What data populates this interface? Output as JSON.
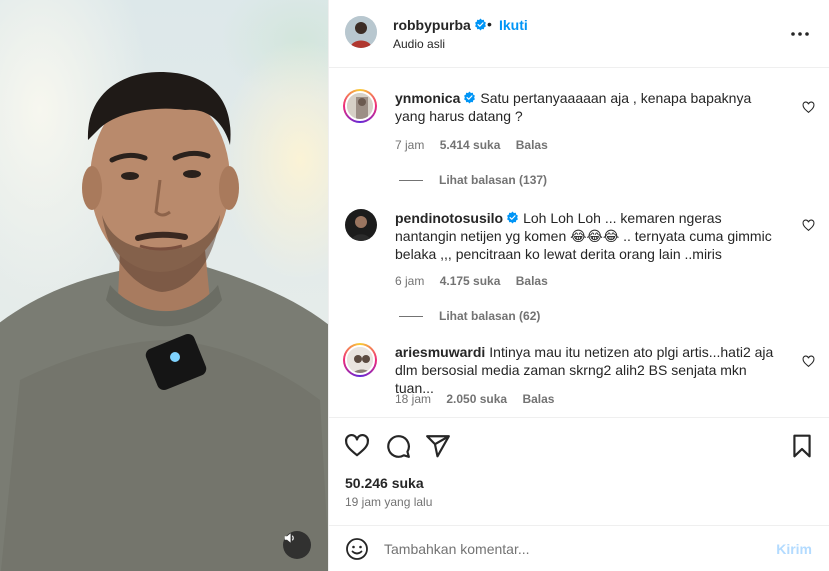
{
  "post": {
    "author": "robbypurba",
    "follow_label": "Ikuti",
    "separator": "•",
    "audio_label": "Audio asli",
    "likes": "50.246 suka",
    "time_ago": "19 jam yang lalu"
  },
  "comments": [
    {
      "username": "ynmonica",
      "verified": true,
      "text": "Satu pertanyaaaaan aja , kenapa bapaknya yang harus datang ?",
      "time": "7 jam",
      "likes": "5.414 suka",
      "reply_label": "Balas",
      "view_replies": "Lihat balasan (137)"
    },
    {
      "username": "pendinotosusilo",
      "verified": true,
      "text": "Loh Loh Loh ... kemaren ngeras nantangin netijen yg komen 😂😂😂 .. ternyata cuma gimmic belaka ,,, pencitraan ko lewat derita orang lain ..miris",
      "time": "6 jam",
      "likes": "4.175 suka",
      "reply_label": "Balas",
      "view_replies": "Lihat balasan (62)"
    },
    {
      "username": "ariesmuwardi",
      "verified": false,
      "text": "Intinya mau itu netizen ato plgi artis...hati2 aja dlm bersosial media zaman skrng2 alih2 BS senjata mkn tuan...",
      "time": "18 jam",
      "likes": "2.050 suka",
      "reply_label": "Balas"
    }
  ],
  "comment_input": {
    "placeholder": "Tambahkan komentar...",
    "send_label": "Kirim"
  },
  "icons": {
    "more": "more-horizontal-icon",
    "like": "heart-icon",
    "comment": "comment-icon",
    "share": "send-icon",
    "save": "bookmark-icon",
    "emoji": "emoji-icon",
    "audio": "speaker-icon",
    "verified": "verified-badge-icon"
  },
  "colors": {
    "link_blue": "#0095f6",
    "send_disabled": "#b3dbff",
    "secondary_text": "#737373",
    "primary_text": "#262626",
    "verified": "#0095f6"
  }
}
